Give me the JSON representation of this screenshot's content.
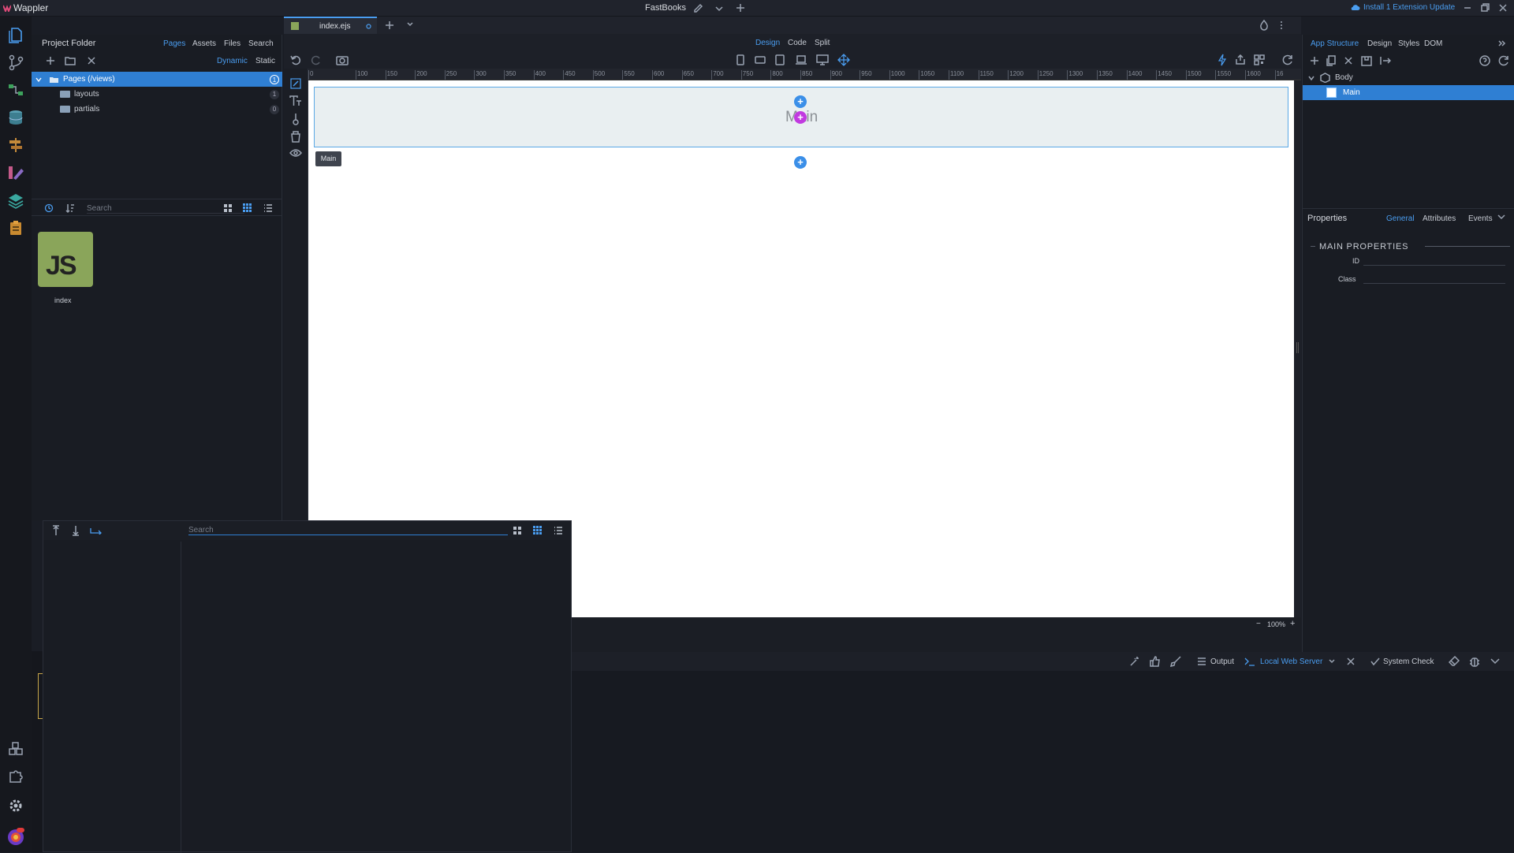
{
  "titlebar": {
    "app_name": "Wappler",
    "project": "FastBooks",
    "extension_update": "Install 1 Extension Update"
  },
  "project_panel": {
    "title": "Project Folder",
    "tabs": [
      "Pages",
      "Assets",
      "Files",
      "Search"
    ],
    "mode_dynamic": "Dynamic",
    "mode_static": "Static",
    "tree": [
      {
        "label": "Pages (/views)",
        "count": "1"
      },
      {
        "label": "layouts",
        "count": "1"
      },
      {
        "label": "partials",
        "count": "0"
      }
    ],
    "search_placeholder": "Search",
    "file_name": "index",
    "file_icon_text": "JS"
  },
  "editor": {
    "tab_name": "index.ejs",
    "view_modes": [
      "Design",
      "Code",
      "Split"
    ],
    "ruler_ticks": [
      "0",
      "100",
      "150",
      "200",
      "250",
      "300",
      "350",
      "400",
      "450",
      "500",
      "550",
      "600",
      "650",
      "700",
      "750",
      "800",
      "850",
      "900",
      "950",
      "1000",
      "1050",
      "1100",
      "1150",
      "1200",
      "1250",
      "1300",
      "1350",
      "1400",
      "1450",
      "1500",
      "1550",
      "1600",
      "16"
    ],
    "main_text": "Main",
    "tooltip": "Main",
    "zoom": "100%"
  },
  "right_panel": {
    "tabs": [
      "App Structure",
      "Design",
      "Styles",
      "DOM"
    ],
    "tree": [
      {
        "label": "Body"
      },
      {
        "label": "Main"
      }
    ],
    "properties_title": "Properties",
    "properties_tabs": [
      "General",
      "Attributes",
      "Events"
    ],
    "section_title": "MAIN PROPERTIES",
    "fields": [
      {
        "label": "ID",
        "value": ""
      },
      {
        "label": "Class",
        "value": ""
      }
    ]
  },
  "bottom_panel": {
    "search_placeholder": "Search"
  },
  "output_bar": {
    "output_label": "Output",
    "server_label": "Local Web Server",
    "system_check": "System Check"
  },
  "colors": {
    "accent": "#4a9df0",
    "selection": "#2f7fd3",
    "background": "#1a1d25"
  }
}
